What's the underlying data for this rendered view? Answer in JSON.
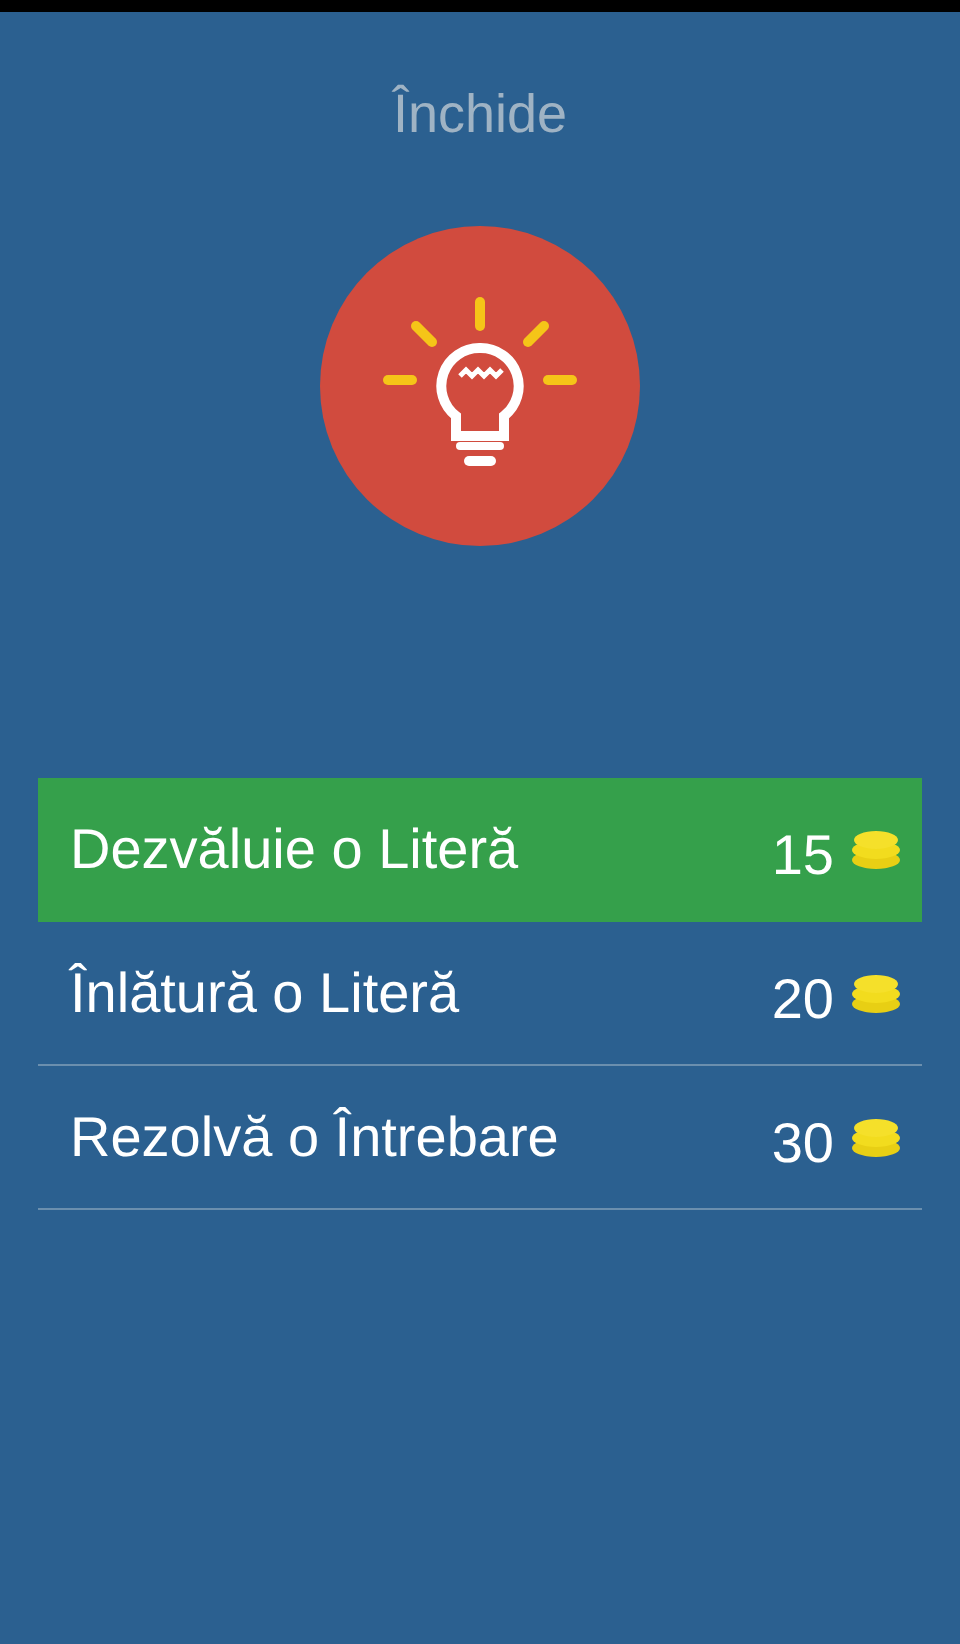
{
  "close_button": {
    "label": "Închide"
  },
  "hints": [
    {
      "label": "Dezvăluie o Literă",
      "price": "15",
      "selected": true
    },
    {
      "label": "Înlătură o Literă",
      "price": "20",
      "selected": false
    },
    {
      "label": "Rezolvă o Întrebare",
      "price": "30",
      "selected": false
    }
  ]
}
